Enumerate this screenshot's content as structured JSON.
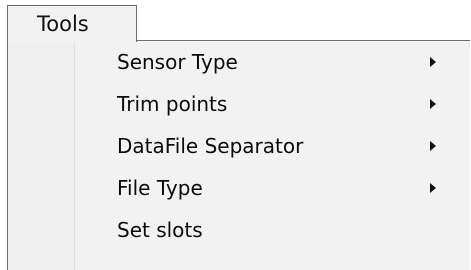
{
  "menubar": {
    "active_menu": "Tools"
  },
  "menu": {
    "items": [
      {
        "label": "Sensor Type",
        "submenu": true
      },
      {
        "label": "Trim points",
        "submenu": true
      },
      {
        "label": "DataFile Separator",
        "submenu": true
      },
      {
        "label": "File Type",
        "submenu": true
      },
      {
        "label": "Set slots",
        "submenu": false
      }
    ]
  }
}
